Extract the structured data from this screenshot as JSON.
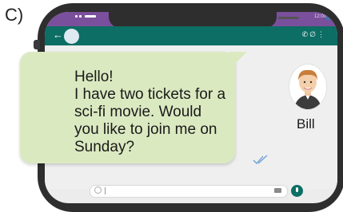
{
  "figure_label": "C)",
  "status_bar": {
    "time": "12:00"
  },
  "chat_header": {
    "back_icon": "arrow-left-icon",
    "icons": [
      "phone-icon",
      "paperclip-icon",
      "more-vert-icon"
    ]
  },
  "message": {
    "lines": [
      "Hello!",
      "I have two tickets for a",
      "sci-fi movie. Would",
      "you like to join me on",
      "Sunday?"
    ],
    "status_icon": "double-check-icon"
  },
  "contact": {
    "name": "Bill"
  },
  "input_bar": {
    "icons": [
      "emoji-icon",
      "camera-icon",
      "mic-icon"
    ]
  },
  "colors": {
    "header": "#0c6e64",
    "status_bar": "#7a4f9c",
    "bubble": "#dbe9c1",
    "phone_frame": "#2e2e2e"
  }
}
